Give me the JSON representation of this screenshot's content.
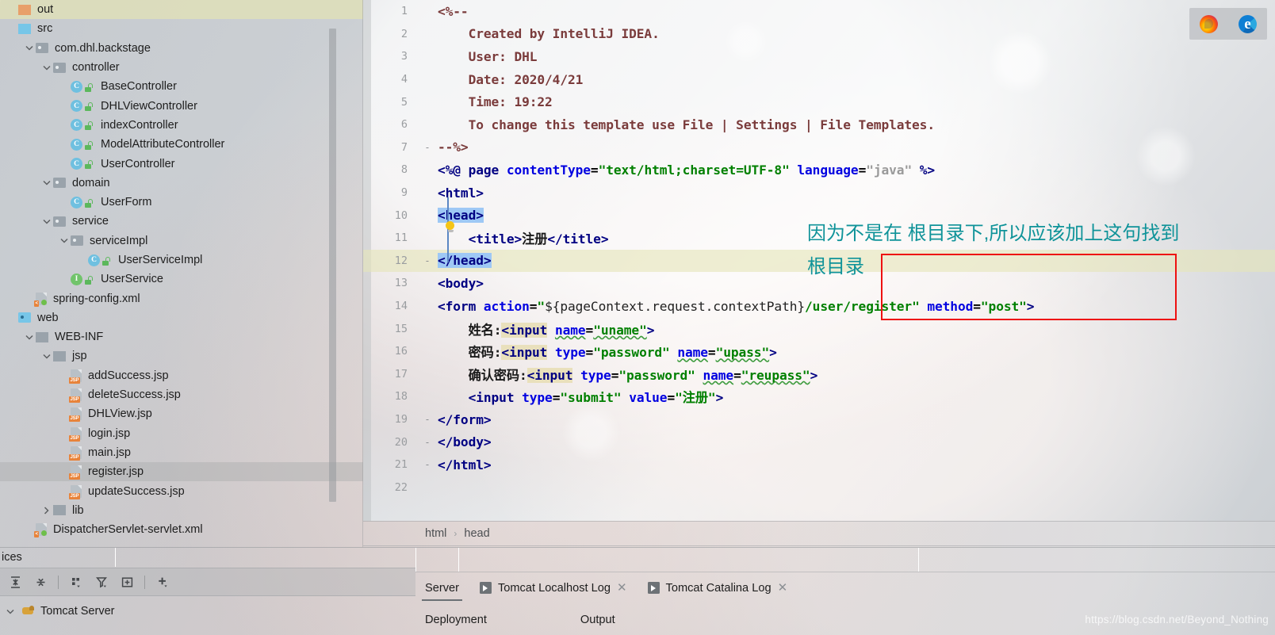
{
  "sidebar": {
    "scrollbar_name": "project-tree-scrollbar",
    "items": [
      {
        "label": "out",
        "icon": "folder-orange-icon",
        "depth": 0,
        "arrow": "none",
        "highlight": "yellow",
        "kind": "folder-orange"
      },
      {
        "label": "src",
        "icon": "folder-blue-icon",
        "depth": 0,
        "arrow": "none",
        "highlight": "none",
        "kind": "folder-blue"
      },
      {
        "label": "com.dhl.backstage",
        "icon": "package-icon",
        "depth": 1,
        "arrow": "expanded",
        "highlight": "none",
        "kind": "package"
      },
      {
        "label": "controller",
        "icon": "package-icon",
        "depth": 2,
        "arrow": "expanded",
        "highlight": "none",
        "kind": "package"
      },
      {
        "label": "BaseController",
        "icon": "java-class-icon",
        "depth": 3,
        "arrow": "none",
        "highlight": "none",
        "kind": "class"
      },
      {
        "label": "DHLViewController",
        "icon": "java-class-icon",
        "depth": 3,
        "arrow": "none",
        "highlight": "none",
        "kind": "class"
      },
      {
        "label": "indexController",
        "icon": "java-class-icon",
        "depth": 3,
        "arrow": "none",
        "highlight": "none",
        "kind": "class"
      },
      {
        "label": "ModelAttributeController",
        "icon": "java-class-icon",
        "depth": 3,
        "arrow": "none",
        "highlight": "none",
        "kind": "class"
      },
      {
        "label": "UserController",
        "icon": "java-class-icon",
        "depth": 3,
        "arrow": "none",
        "highlight": "none",
        "kind": "class"
      },
      {
        "label": "domain",
        "icon": "package-icon",
        "depth": 2,
        "arrow": "expanded",
        "highlight": "none",
        "kind": "package"
      },
      {
        "label": "UserForm",
        "icon": "java-class-icon",
        "depth": 3,
        "arrow": "none",
        "highlight": "none",
        "kind": "class"
      },
      {
        "label": "service",
        "icon": "package-icon",
        "depth": 2,
        "arrow": "expanded",
        "highlight": "none",
        "kind": "package"
      },
      {
        "label": "serviceImpl",
        "icon": "package-icon",
        "depth": 3,
        "arrow": "expanded",
        "highlight": "none",
        "kind": "package"
      },
      {
        "label": "UserServiceImpl",
        "icon": "java-class-icon",
        "depth": 4,
        "arrow": "none",
        "highlight": "none",
        "kind": "class"
      },
      {
        "label": "UserService",
        "icon": "java-interface-icon",
        "depth": 3,
        "arrow": "none",
        "highlight": "none",
        "kind": "interface"
      },
      {
        "label": "spring-config.xml",
        "icon": "xml-file-icon",
        "depth": 1,
        "arrow": "none",
        "highlight": "none",
        "kind": "xml"
      },
      {
        "label": "web",
        "icon": "web-folder-icon",
        "depth": 0,
        "arrow": "none",
        "highlight": "none",
        "kind": "webdir"
      },
      {
        "label": "WEB-INF",
        "icon": "folder-grey-icon",
        "depth": 1,
        "arrow": "expanded",
        "highlight": "none",
        "kind": "folder-grey"
      },
      {
        "label": "jsp",
        "icon": "folder-grey-icon",
        "depth": 2,
        "arrow": "expanded",
        "highlight": "none",
        "kind": "folder-grey"
      },
      {
        "label": "addSuccess.jsp",
        "icon": "jsp-file-icon",
        "depth": 3,
        "arrow": "none",
        "highlight": "none",
        "kind": "jsp"
      },
      {
        "label": "deleteSuccess.jsp",
        "icon": "jsp-file-icon",
        "depth": 3,
        "arrow": "none",
        "highlight": "none",
        "kind": "jsp"
      },
      {
        "label": "DHLView.jsp",
        "icon": "jsp-file-icon",
        "depth": 3,
        "arrow": "none",
        "highlight": "none",
        "kind": "jsp"
      },
      {
        "label": "login.jsp",
        "icon": "jsp-file-icon",
        "depth": 3,
        "arrow": "none",
        "highlight": "none",
        "kind": "jsp"
      },
      {
        "label": "main.jsp",
        "icon": "jsp-file-icon",
        "depth": 3,
        "arrow": "none",
        "highlight": "none",
        "kind": "jsp"
      },
      {
        "label": "register.jsp",
        "icon": "jsp-file-icon",
        "depth": 3,
        "arrow": "none",
        "highlight": "grey",
        "kind": "jsp"
      },
      {
        "label": "updateSuccess.jsp",
        "icon": "jsp-file-icon",
        "depth": 3,
        "arrow": "none",
        "highlight": "none",
        "kind": "jsp"
      },
      {
        "label": "lib",
        "icon": "folder-grey-icon",
        "depth": 2,
        "arrow": "collapsed",
        "highlight": "none",
        "kind": "folder-grey"
      },
      {
        "label": "DispatcherServlet-servlet.xml",
        "icon": "xml-file-icon",
        "depth": 1,
        "arrow": "none",
        "highlight": "none",
        "kind": "xml"
      }
    ]
  },
  "services": {
    "title": "ices",
    "toolbar_icons": [
      "expand-all-icon",
      "collapse-all-icon",
      "group-by-icon",
      "filter-icon",
      "add-frame-icon",
      "add-icon"
    ],
    "server_label": "Tomcat Server",
    "server_icon": "tomcat-cat-icon"
  },
  "editor": {
    "current_line": 12,
    "lines": [
      {
        "n": "1",
        "fold": "",
        "text": "<%--"
      },
      {
        "n": "2",
        "fold": "",
        "text": "    Created by IntelliJ IDEA."
      },
      {
        "n": "3",
        "fold": "",
        "text": "    User: DHL"
      },
      {
        "n": "4",
        "fold": "",
        "text": "    Date: 2020/4/21"
      },
      {
        "n": "5",
        "fold": "",
        "text": "    Time: 19:22"
      },
      {
        "n": "6",
        "fold": "",
        "text": "    To change this template use File | Settings | File Templates."
      },
      {
        "n": "7",
        "fold": "-",
        "text": "--%>"
      },
      {
        "n": "8",
        "fold": "",
        "text": "<%@ page contentType=\"text/html;charset=UTF-8\" language=\"java\" %>"
      },
      {
        "n": "9",
        "fold": "",
        "text": "<html>"
      },
      {
        "n": "10",
        "fold": "",
        "text": "<head>"
      },
      {
        "n": "11",
        "fold": "",
        "text": "    <title>注册</title>"
      },
      {
        "n": "12",
        "fold": "-",
        "text": "</head>"
      },
      {
        "n": "13",
        "fold": "",
        "text": "<body>"
      },
      {
        "n": "14",
        "fold": "",
        "text": "<form action=\"${pageContext.request.contextPath}/user/register\" method=\"post\">"
      },
      {
        "n": "15",
        "fold": "",
        "text": "    姓名:<input name=\"uname\">"
      },
      {
        "n": "16",
        "fold": "",
        "text": "    密码:<input type=\"password\" name=\"upass\">"
      },
      {
        "n": "17",
        "fold": "",
        "text": "    确认密码:<input type=\"password\" name=\"reupass\">"
      },
      {
        "n": "18",
        "fold": "",
        "text": "    <input type=\"submit\" value=\"注册\">"
      },
      {
        "n": "19",
        "fold": "-",
        "text": "</form>"
      },
      {
        "n": "20",
        "fold": "-",
        "text": "</body>"
      },
      {
        "n": "21",
        "fold": "-",
        "text": "</html>"
      },
      {
        "n": "22",
        "fold": "",
        "text": ""
      }
    ],
    "annotation": {
      "text": "因为不是在 根目录下,所以应该加上这句找到\n根目录",
      "color": "#0f9399",
      "box_color": "#ee1111"
    }
  },
  "breadcrumb": {
    "items": [
      "html",
      "head"
    ],
    "separator": "›"
  },
  "bottom_tool": {
    "tabs": [
      {
        "label": "Server",
        "icon": "none",
        "closable": false,
        "active": true
      },
      {
        "label": "Tomcat Localhost Log",
        "icon": "run-icon",
        "closable": true,
        "active": false
      },
      {
        "label": "Tomcat Catalina Log",
        "icon": "run-icon",
        "closable": true,
        "active": false
      }
    ],
    "sub_tabs": [
      "Deployment",
      "Output"
    ]
  },
  "browser_popup": {
    "browsers": [
      {
        "name": "firefox-icon"
      },
      {
        "name": "edge-icon"
      }
    ]
  },
  "watermark": {
    "text": "https://blog.csdn.net/Beyond_Nothing"
  }
}
